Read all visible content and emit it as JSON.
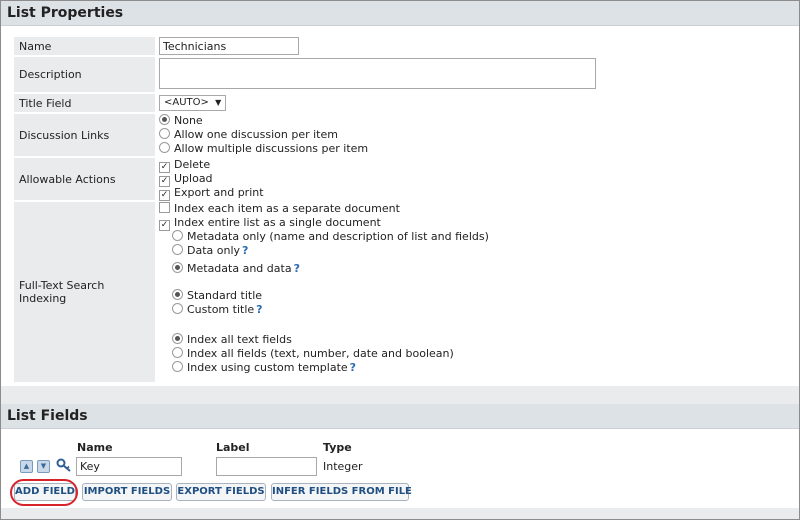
{
  "list_properties": {
    "title": "List Properties",
    "rows": {
      "name": {
        "label": "Name",
        "value": "Technicians"
      },
      "description": {
        "label": "Description",
        "value": ""
      },
      "title_field": {
        "label": "Title Field",
        "value": "<AUTO>",
        "arrow": "▼"
      },
      "discussion_links": {
        "label": "Discussion Links",
        "options": [
          "None",
          "Allow one discussion per item",
          "Allow multiple discussions per item"
        ],
        "selected": "None"
      },
      "allowable_actions": {
        "label": "Allowable Actions",
        "options": [
          "Delete",
          "Upload",
          "Export and print"
        ],
        "checked": [
          true,
          true,
          true
        ]
      },
      "full_text_search": {
        "label": "Full-Text Search Indexing",
        "index_each_item": {
          "label": "Index each item as a separate document",
          "checked": false
        },
        "index_entire_list": {
          "label": "Index entire list as a single document",
          "checked": true
        },
        "content_options": [
          "Metadata only (name and description of list and fields)",
          "Data only",
          "Metadata and data"
        ],
        "content_selected": "Metadata and data",
        "title_options": [
          "Standard title",
          "Custom title"
        ],
        "title_selected": "Standard title",
        "field_options": [
          "Index all text fields",
          "Index all fields (text, number, date and boolean)",
          "Index using custom template"
        ],
        "field_selected": "Index all text fields",
        "help_mark": "?"
      }
    }
  },
  "list_fields": {
    "title": "List Fields",
    "columns": {
      "name": "Name",
      "label": "Label",
      "type": "Type"
    },
    "fields": [
      {
        "name": "Key",
        "label": "",
        "type": "Integer",
        "is_key": true
      }
    ],
    "buttons": {
      "add_field": "ADD FIELD",
      "import_fields": "IMPORT FIELDS",
      "export_fields": "EXPORT FIELDS",
      "infer_fields": "INFER FIELDS FROM FILE"
    }
  },
  "colors": {
    "highlight": "#d8232a",
    "link": "#2b6cb0",
    "header_bg": "#dde2e6"
  }
}
